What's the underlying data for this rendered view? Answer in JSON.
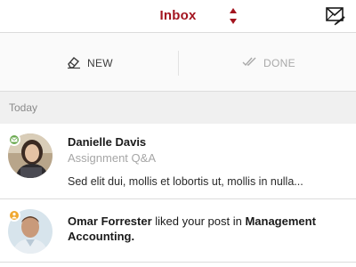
{
  "header": {
    "title": "Inbox",
    "accent_color": "#a3141f",
    "sort_icon": "sort-arrows-icon",
    "compose_icon": "envelope-compose-icon"
  },
  "actions": {
    "new_label": "NEW",
    "new_icon": "eraser-pen-icon",
    "done_label": "DONE",
    "done_icon": "double-check-icon"
  },
  "section": {
    "label": "Today"
  },
  "messages": [
    {
      "sender": "Danielle Davis",
      "subject": "Assignment Q&A",
      "preview": "Sed elit dui, mollis et lobortis ut, mollis in nulla...",
      "badge_color": "#6aa84f",
      "badge_icon": "mail-badge-icon"
    }
  ],
  "notifications": [
    {
      "actor": "Omar Forrester",
      "action": " liked your post in ",
      "target": "Management Accounting.",
      "badge_color": "#f0a830",
      "badge_icon": "person-badge-icon"
    }
  ]
}
